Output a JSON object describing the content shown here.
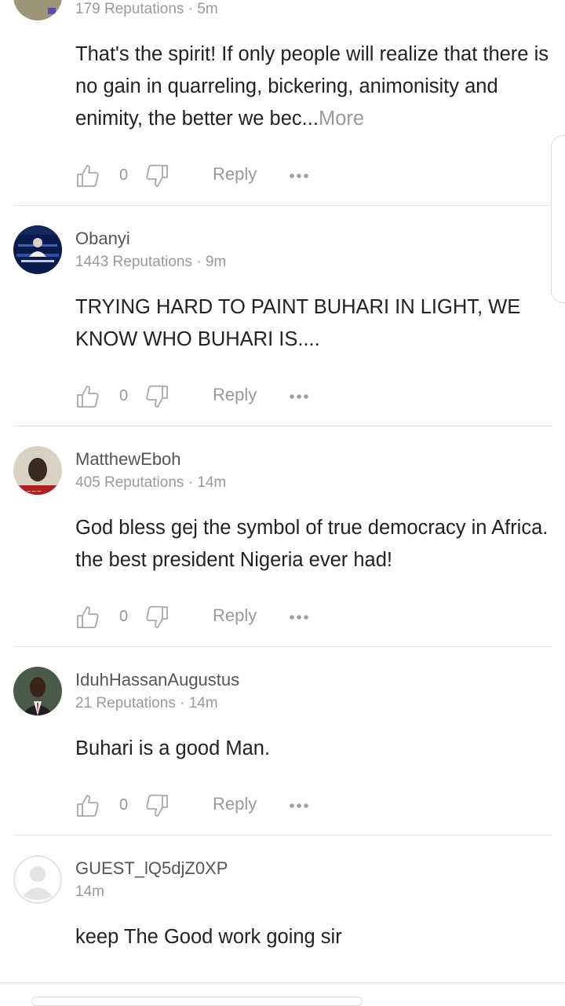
{
  "comments": [
    {
      "meta": "179 Reputations · 5m",
      "text": "That's the spirit!  If only people will realize that there is no gain in quarreling, bickering, animonisity and enimity, the better we bec...",
      "more": "More",
      "likes": "0",
      "reply": "Reply"
    },
    {
      "username": "Obanyi",
      "meta": "1443 Reputations · 9m",
      "text": "TRYING HARD TO PAINT BUHARI IN LIGHT, WE KNOW WHO BUHARI IS....",
      "likes": "0",
      "reply": "Reply"
    },
    {
      "username": "MatthewEboh",
      "meta": "405 Reputations · 14m",
      "text": "God bless gej the symbol of true democracy in Africa. the best president Nigeria ever had!",
      "likes": "0",
      "reply": "Reply"
    },
    {
      "username": "IduhHassanAugustus",
      "meta": "21 Reputations · 14m",
      "text": "Buhari is a good Man.",
      "likes": "0",
      "reply": "Reply"
    },
    {
      "username": "GUEST_lQ5djZ0XP",
      "meta": "14m",
      "text": "keep The Good work going sir"
    }
  ]
}
